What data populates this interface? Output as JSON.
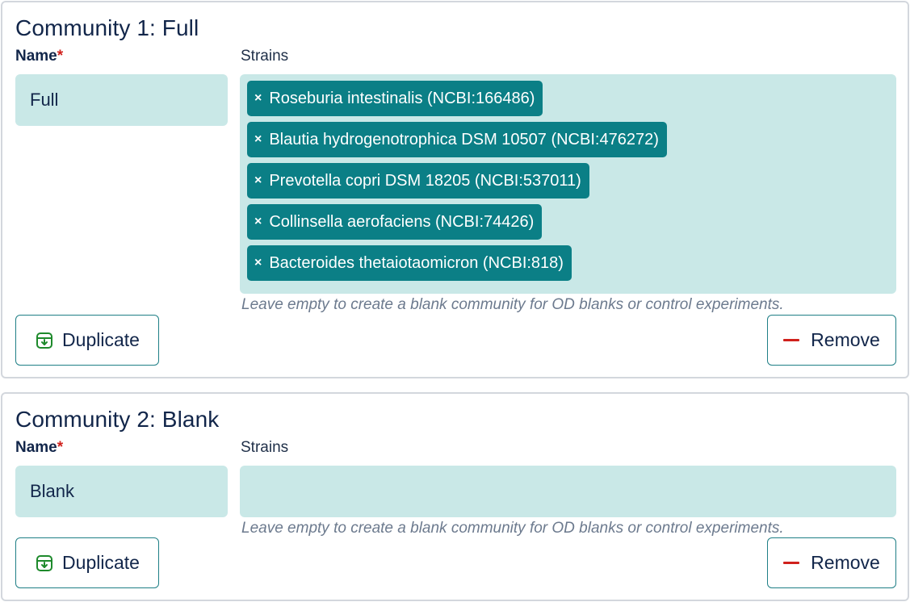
{
  "communities": [
    {
      "title": "Community 1: Full",
      "name_label": "Name",
      "required_mark": "*",
      "strains_label": "Strains",
      "name_value": "Full",
      "strains": [
        "Roseburia intestinalis (NCBI:166486)",
        "Blautia hydrogenotrophica DSM 10507 (NCBI:476272)",
        "Prevotella copri DSM 18205 (NCBI:537011)",
        "Collinsella aerofaciens (NCBI:74426)",
        "Bacteroides thetaiotaomicron (NCBI:818)"
      ],
      "chip_remove_glyph": "×",
      "helper": "Leave empty to create a blank community for OD blanks or control experiments.",
      "duplicate_label": "Duplicate",
      "remove_label": "Remove"
    },
    {
      "title": "Community 2: Blank",
      "name_label": "Name",
      "required_mark": "*",
      "strains_label": "Strains",
      "name_value": "Blank",
      "strains": [],
      "helper": "Leave empty to create a blank community for OD blanks or control experiments.",
      "duplicate_label": "Duplicate",
      "remove_label": "Remove"
    }
  ],
  "colors": {
    "chip_bg": "#0b7f86",
    "input_bg": "#c9e8e7",
    "required": "#d0211c",
    "duplicate_icon": "#1e8a2c",
    "remove_icon": "#d0211c"
  },
  "icons": {
    "duplicate": "duplicate-down-icon",
    "remove": "minus-icon",
    "chip_remove": "close-icon"
  }
}
